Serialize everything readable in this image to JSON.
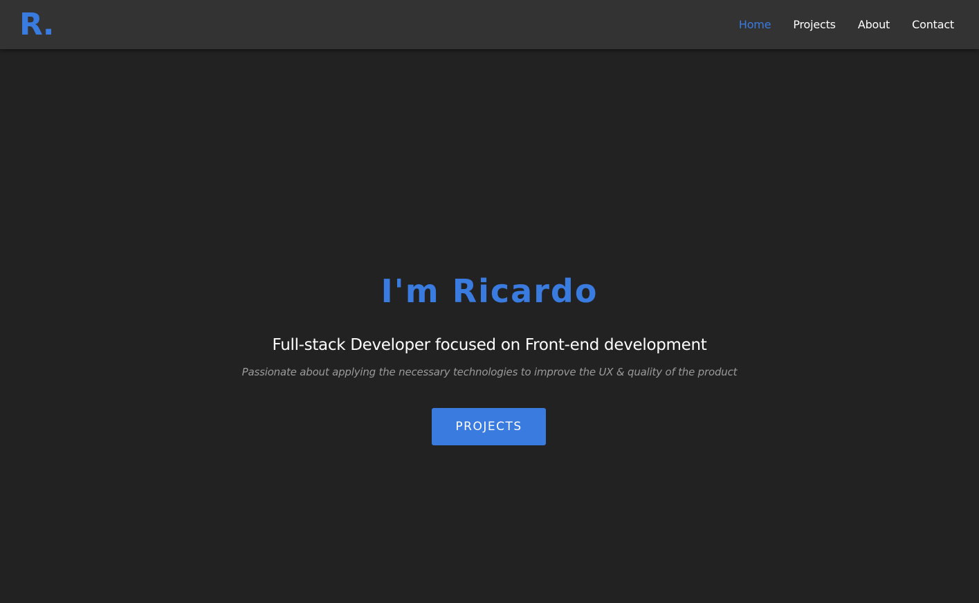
{
  "nav": {
    "logo": "R.",
    "links": [
      {
        "label": "Home",
        "active": true
      },
      {
        "label": "Projects",
        "active": false
      },
      {
        "label": "About",
        "active": false
      },
      {
        "label": "Contact",
        "active": false
      }
    ]
  },
  "hero": {
    "title": "I'm Ricardo",
    "subtitle": "Full-stack Developer focused on Front-end development",
    "tagline": "Passionate about applying the necessary technologies to improve the UX & quality of the product",
    "button_label": "PROJECTS"
  },
  "colors": {
    "accent": "#3a7bdf",
    "background": "#222222",
    "navbar": "#333333",
    "text": "#ffffff",
    "muted_text": "#9a9a9a"
  }
}
